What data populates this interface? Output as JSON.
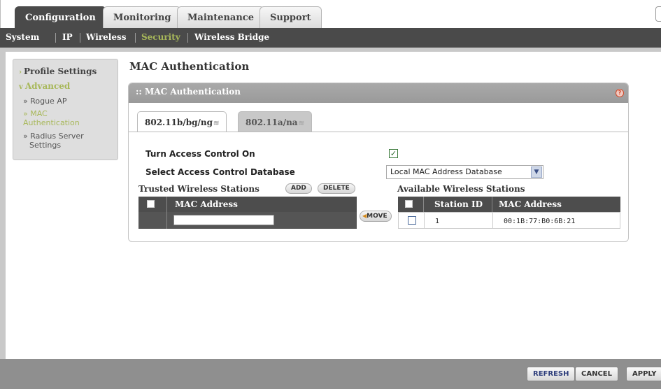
{
  "top_tabs": [
    "Configuration",
    "Monitoring",
    "Maintenance",
    "Support"
  ],
  "sub_nav": [
    "System",
    "IP",
    "Wireless",
    "Security",
    "Wireless Bridge"
  ],
  "sidebar": {
    "profile_settings": "Profile Settings",
    "advanced": "Advanced",
    "rogue_ap": "» Rogue AP",
    "mac_auth_line1": "» MAC",
    "mac_auth_line2": "Authentication",
    "radius_line1": "» Radius Server",
    "radius_line2": "Settings"
  },
  "page_title": "MAC Authentication",
  "panel": {
    "title": ":: MAC Authentication",
    "help": "?",
    "radio_tabs": [
      "802.11b/bg/ng",
      "802.11a/na"
    ],
    "turn_on_label": "Turn Access Control On",
    "turn_on_checked": "✓",
    "select_db_label": "Select Access Control Database",
    "select_db_value": "Local MAC Address Database",
    "trusted_title": "Trusted Wireless Stations",
    "add_label": "ADD",
    "delete_label": "DELETE",
    "available_title": "Available Wireless Stations",
    "move_label": "MOVE",
    "trusted_headers": [
      "MAC Address"
    ],
    "available_headers": [
      "Station ID",
      "MAC Address"
    ],
    "available_rows": [
      {
        "station_id": "1",
        "mac": "00:1B:77:B0:6B:21"
      }
    ]
  },
  "footer": {
    "refresh": "REFRESH",
    "cancel": "CANCEL",
    "apply": "APPLY"
  }
}
